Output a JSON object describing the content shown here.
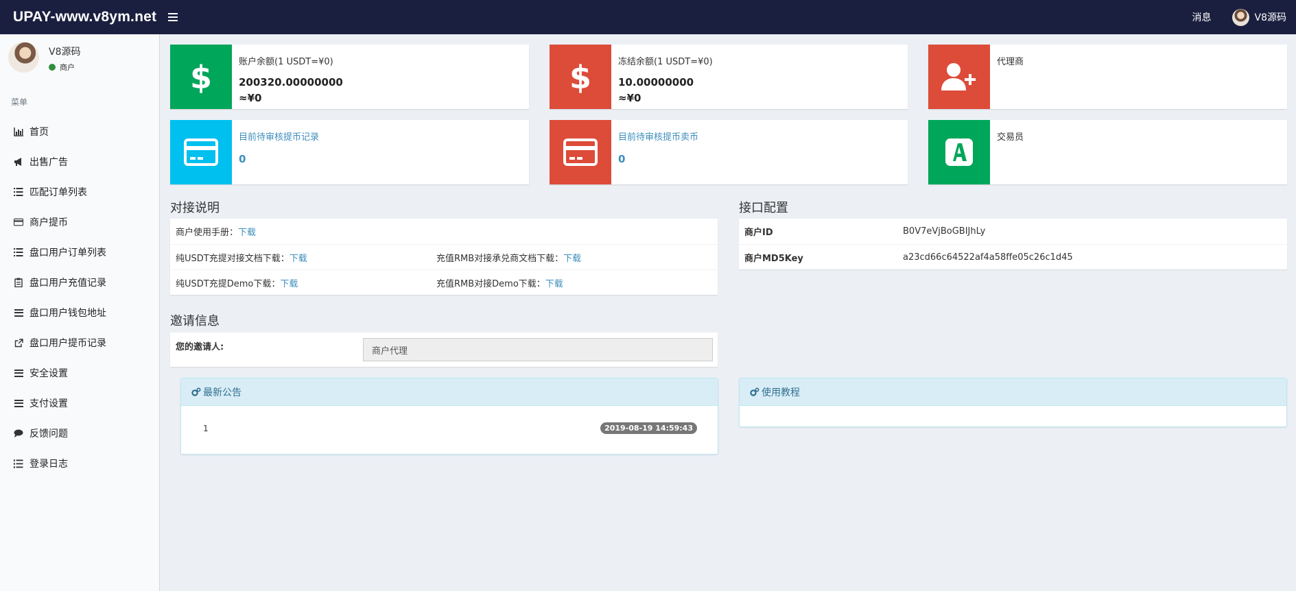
{
  "header": {
    "brand": "UPAY-www.v8ym.net",
    "messages_label": "消息",
    "username": "V8源码"
  },
  "sidebar": {
    "user_name": "V8源码",
    "user_role": "商户",
    "menu_header": "菜单",
    "items": [
      {
        "label": "首页",
        "icon": "bar-chart-icon"
      },
      {
        "label": "出售广告",
        "icon": "bullhorn-icon"
      },
      {
        "label": "匹配订单列表",
        "icon": "list-icon"
      },
      {
        "label": "商户提币",
        "icon": "credit-card-icon"
      },
      {
        "label": "盘口用户订单列表",
        "icon": "list-icon"
      },
      {
        "label": "盘口用户充值记录",
        "icon": "clipboard-icon"
      },
      {
        "label": "盘口用户钱包地址",
        "icon": "bars-icon"
      },
      {
        "label": "盘口用户提币记录",
        "icon": "external-link-icon"
      },
      {
        "label": "安全设置",
        "icon": "bars-icon"
      },
      {
        "label": "支付设置",
        "icon": "bars-icon"
      },
      {
        "label": "反馈问题",
        "icon": "comment-icon"
      },
      {
        "label": "登录日志",
        "icon": "list-ol-icon"
      }
    ]
  },
  "stats": {
    "balance": {
      "label": "账户余额(1 USDT=¥0)",
      "value": "200320.00000000",
      "cny": "≈¥0"
    },
    "frozen": {
      "label": "冻结余额(1 USDT=¥0)",
      "value": "10.00000000",
      "cny": "≈¥0"
    },
    "agent": {
      "label": "代理商"
    },
    "pending_withdraw": {
      "label": "目前待审核提币记录",
      "value": "0"
    },
    "pending_sell": {
      "label": "目前待审核提币卖币",
      "value": "0"
    },
    "trader": {
      "label": "交易员"
    }
  },
  "integration": {
    "title": "对接说明",
    "manual_label": "商户使用手册：",
    "download": "下载",
    "usdt_doc_label": "纯USDT充提对接文档下载：",
    "rmb_doc_label": "充值RMB对接承兑商文档下载：",
    "usdt_demo_label": "纯USDT充提Demo下载：",
    "rmb_demo_label": "充值RMB对接Demo下载："
  },
  "api_config": {
    "title": "接口配置",
    "merchant_id_label": "商户ID",
    "merchant_id": "B0V7eVjBoGBIJhLy",
    "md5key_label": "商户MD5Key",
    "md5key": "a23cd66c64522af4a58ffe05c26c1d45"
  },
  "invite": {
    "title": "邀请信息",
    "inviter_label": "您的邀请人:",
    "inviter_value": "商户代理"
  },
  "notice": {
    "title": "最新公告",
    "item_text": "1",
    "item_date": "2019-08-19 14:59:43"
  },
  "tutorial": {
    "title": "使用教程"
  }
}
